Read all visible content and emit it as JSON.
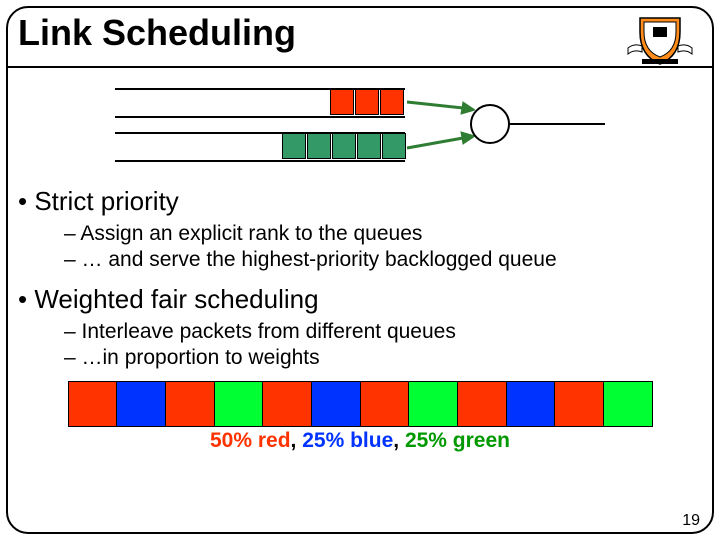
{
  "title": "Link Scheduling",
  "bullets": {
    "strict": {
      "main": "• Strict priority",
      "sub1": "– Assign an explicit rank to the queues",
      "sub2": "– … and serve the highest-priority backlogged queue"
    },
    "wfs": {
      "main": "• Weighted fair scheduling",
      "sub1": "– Interleave packets from different queues",
      "sub2": "– …in proportion to weights"
    }
  },
  "queue_diagram": {
    "top_queue_packets": 3,
    "top_color": "red",
    "bottom_queue_packets": 5,
    "bottom_color": "green"
  },
  "wfs_sequence": [
    "red",
    "blue",
    "red",
    "green",
    "red",
    "blue",
    "red",
    "green",
    "red",
    "blue",
    "red",
    "green"
  ],
  "wfs_caption": {
    "red": "50% red",
    "sep": ", ",
    "blue": "25% blue",
    "green": "25% green"
  },
  "page_number": "19"
}
